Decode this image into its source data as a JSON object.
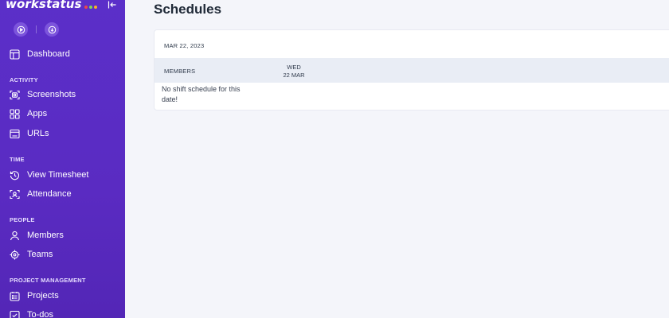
{
  "brand": {
    "name": "workstatus",
    "dot_colors": [
      "#f04747",
      "#7ed957",
      "#ffb020"
    ]
  },
  "sidebar": {
    "top_buttons": [
      {
        "icon": "play-circle-icon"
      },
      {
        "icon": "download-circle-icon"
      }
    ],
    "dashboard": {
      "label": "Dashboard",
      "icon": "layout-icon"
    },
    "sections": [
      {
        "label": "ACTIVITY",
        "items": [
          {
            "label": "Screenshots",
            "icon": "screenshot-icon"
          },
          {
            "label": "Apps",
            "icon": "apps-grid-icon"
          },
          {
            "label": "URLs",
            "icon": "browser-window-icon"
          }
        ]
      },
      {
        "label": "TIME",
        "items": [
          {
            "label": "View Timesheet",
            "icon": "history-clock-icon"
          },
          {
            "label": "Attendance",
            "icon": "face-scan-icon"
          }
        ]
      },
      {
        "label": "PEOPLE",
        "items": [
          {
            "label": "Members",
            "icon": "user-icon"
          },
          {
            "label": "Teams",
            "icon": "target-icon"
          }
        ]
      },
      {
        "label": "PROJECT MANAGEMENT",
        "items": [
          {
            "label": "Projects",
            "icon": "project-list-icon"
          },
          {
            "label": "To-dos",
            "icon": "todo-icon"
          }
        ]
      }
    ]
  },
  "main": {
    "title": "Schedules",
    "card": {
      "date": "MAR 22, 2023",
      "columns": {
        "members": "MEMBERS",
        "day_name": "WED",
        "day_date": "22 MAR"
      },
      "empty_message": "No shift schedule for this date!"
    }
  },
  "colors": {
    "sidebar": "#5b2fc9",
    "background": "#f4f5fa",
    "table_header": "#e9edf5"
  }
}
